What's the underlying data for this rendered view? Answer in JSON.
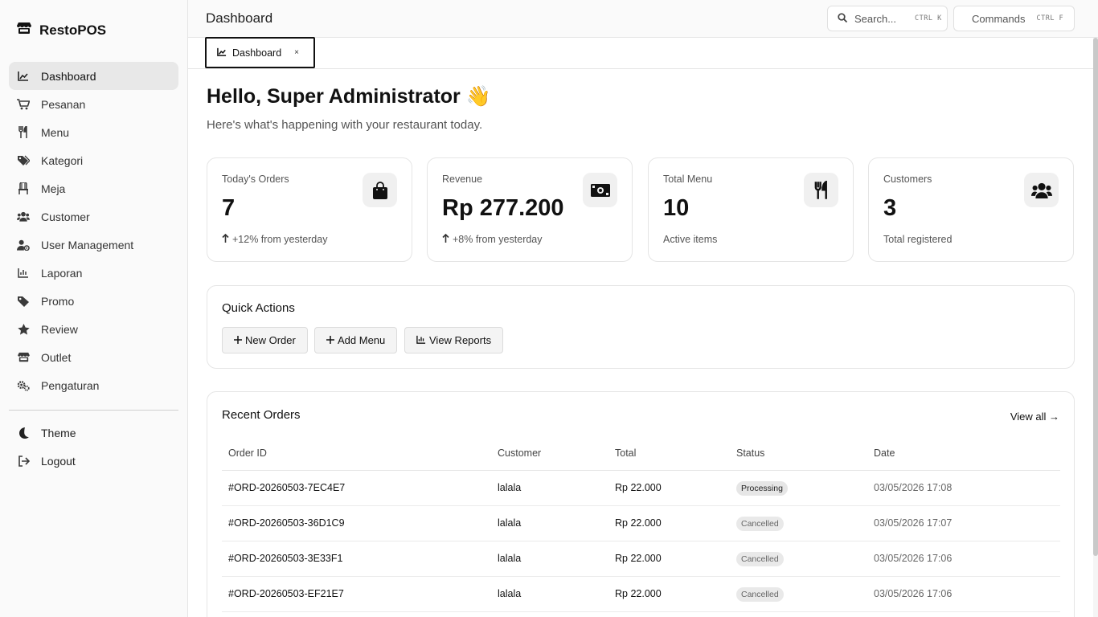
{
  "brand": {
    "name": "RestoPOS"
  },
  "sidebar": {
    "items": [
      {
        "label": "Dashboard",
        "icon": "chart-icon"
      },
      {
        "label": "Pesanan",
        "icon": "cart-icon"
      },
      {
        "label": "Menu",
        "icon": "utensils-icon"
      },
      {
        "label": "Kategori",
        "icon": "tags-icon"
      },
      {
        "label": "Meja",
        "icon": "chair-icon"
      },
      {
        "label": "Customer",
        "icon": "users-icon"
      },
      {
        "label": "User Management",
        "icon": "user-gear-icon"
      },
      {
        "label": "Laporan",
        "icon": "chart-icon"
      },
      {
        "label": "Promo",
        "icon": "tag-icon"
      },
      {
        "label": "Review",
        "icon": "star-icon"
      },
      {
        "label": "Outlet",
        "icon": "store-icon"
      },
      {
        "label": "Pengaturan",
        "icon": "gears-icon"
      }
    ],
    "bottom": [
      {
        "label": "Theme",
        "icon": "moon-icon"
      },
      {
        "label": "Logout",
        "icon": "logout-icon"
      }
    ]
  },
  "header": {
    "title": "Dashboard",
    "search_label": "Search...",
    "search_kbd": "CTRL K",
    "commands_label": "Commands",
    "commands_kbd": "CTRL F"
  },
  "tabs": [
    {
      "label": "Dashboard",
      "close": "×"
    }
  ],
  "main": {
    "greeting": "Hello, Super Administrator 👋",
    "subtitle": "Here's what's happening with your restaurant today.",
    "stats": [
      {
        "label": "Today's Orders",
        "value": "7",
        "foot": "+12% from yesterday",
        "icon": "shopping-bag-icon"
      },
      {
        "label": "Revenue",
        "value": "Rp 277.200",
        "foot": "+8% from yesterday",
        "icon": "money-bill-icon"
      },
      {
        "label": "Total Menu",
        "value": "10",
        "foot": "Active items",
        "icon": "utensils-icon"
      },
      {
        "label": "Customers",
        "value": "3",
        "foot": "Total registered",
        "icon": "users-icon"
      }
    ],
    "quick_actions": {
      "title": "Quick Actions",
      "buttons": [
        "New Order",
        "Add Menu",
        "View Reports"
      ]
    },
    "recent_orders": {
      "title": "Recent Orders",
      "view_all": "View all →",
      "columns": [
        "Order ID",
        "Customer",
        "Total",
        "Status",
        "Date"
      ],
      "rows": [
        {
          "id": "#ORD-20260503-7EC4E7",
          "customer": "lalala",
          "total": "Rp 22.000",
          "status": "Processing",
          "date": "03/05/2026 17:08"
        },
        {
          "id": "#ORD-20260503-36D1C9",
          "customer": "lalala",
          "total": "Rp 22.000",
          "status": "Cancelled",
          "date": "03/05/2026 17:07"
        },
        {
          "id": "#ORD-20260503-3E33F1",
          "customer": "lalala",
          "total": "Rp 22.000",
          "status": "Cancelled",
          "date": "03/05/2026 17:06"
        },
        {
          "id": "#ORD-20260503-EF21E7",
          "customer": "lalala",
          "total": "Rp 22.000",
          "status": "Cancelled",
          "date": "03/05/2026 17:06"
        }
      ]
    }
  }
}
